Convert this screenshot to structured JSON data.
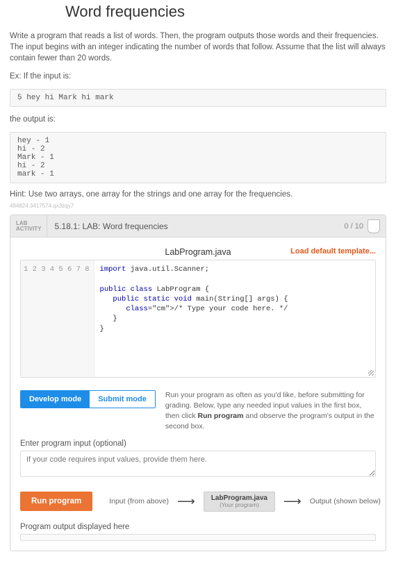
{
  "page": {
    "title": "Word frequencies",
    "description": "Write a program that reads a list of words. Then, the program outputs those words and their frequencies. The input begins with an integer indicating the number of words that follow. Assume that the list will always contain fewer than 20 words.",
    "example_input_label": "Ex: If the input is:",
    "example_input": "5 hey hi Mark hi mark",
    "output_label": "the output is:",
    "example_output": "hey - 1\nhi - 2\nMark - 1\nhi - 2\nmark - 1",
    "hint": "Hint: Use two arrays, one array for the strings and one array for the frequencies.",
    "tiny_id": "484824.3417574.qx3zqy7"
  },
  "lab": {
    "badge_line1": "LAB",
    "badge_line2": "ACTIVITY",
    "title": "5.18.1: LAB: Word frequencies",
    "score": "0 / 10",
    "file_name": "LabProgram.java",
    "load_template": "Load default template...",
    "code_lines": [
      "import java.util.Scanner;",
      "",
      "public class LabProgram {",
      "   public static void main(String[] args) {",
      "      /* Type your code here. */",
      "   }",
      "}",
      ""
    ]
  },
  "modes": {
    "develop": "Develop mode",
    "submit": "Submit mode",
    "description_pre": "Run your program as often as you'd like, before submitting for grading. Below, type any needed input values in the first box, then click ",
    "description_bold": "Run program",
    "description_post": " and observe the program's output in the second box."
  },
  "input": {
    "label": "Enter program input (optional)",
    "placeholder": "If your code requires input values, provide them here."
  },
  "run": {
    "button": "Run program",
    "from": "Input (from above)",
    "box_title": "LabProgram.java",
    "box_sub": "(Your program)",
    "to": "Output (shown below)"
  },
  "output": {
    "label": "Program output displayed here"
  }
}
